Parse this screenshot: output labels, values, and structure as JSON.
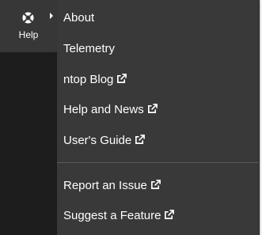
{
  "sidebar": {
    "help_label": "Help"
  },
  "menu": {
    "items": [
      {
        "label": "About",
        "external": false
      },
      {
        "label": "Telemetry",
        "external": false
      },
      {
        "label": "ntop Blog",
        "external": true
      },
      {
        "label": "Help and News",
        "external": true
      },
      {
        "label": "User's Guide",
        "external": true
      },
      {
        "label": "Report an Issue",
        "external": true
      },
      {
        "label": "Suggest a Feature",
        "external": true
      }
    ]
  },
  "icons": {
    "help": "lifebuoy-icon",
    "external": "external-link-icon",
    "caret": "caret-right-icon"
  },
  "colors": {
    "sidebar_bg": "#1d1d1d",
    "sidebar_active_bg": "#373737",
    "menu_bg": "#393939",
    "menu_text": "#ffffff",
    "divider": "#5a5a5a"
  }
}
